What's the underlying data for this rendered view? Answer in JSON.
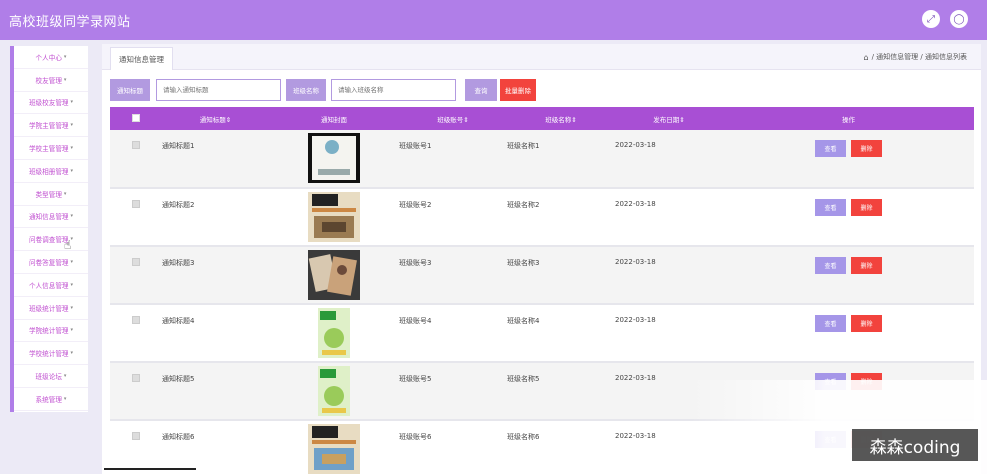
{
  "app": {
    "title": "高校班级同学录网站"
  },
  "top_icons": [
    "fullscreen-icon",
    "user-icon"
  ],
  "sidebar": {
    "items": [
      {
        "label": "个人中心"
      },
      {
        "label": "校友管理"
      },
      {
        "label": "班级校友管理"
      },
      {
        "label": "学院主管管理"
      },
      {
        "label": "学校主管管理"
      },
      {
        "label": "班级相册管理"
      },
      {
        "label": "类型管理"
      },
      {
        "label": "通知信息管理"
      },
      {
        "label": "问卷调查管理"
      },
      {
        "label": "问卷答复管理"
      },
      {
        "label": "个人信息管理"
      },
      {
        "label": "班级统计管理"
      },
      {
        "label": "学院统计管理"
      },
      {
        "label": "学校统计管理"
      },
      {
        "label": "班级论坛"
      },
      {
        "label": "系统管理"
      }
    ]
  },
  "tab": {
    "label": "通知信息管理"
  },
  "breadcrumb": {
    "text": "/ 通知信息管理 / 通知信息列表"
  },
  "search": {
    "title_label": "通知标题",
    "title_placeholder": "请输入通知标题",
    "class_label": "班级名称",
    "class_placeholder": "请输入班级名称",
    "query_button": "查询",
    "batch_delete_button": "批量删除"
  },
  "table": {
    "headers": [
      "通知标题",
      "通知封面",
      "班级账号",
      "班级名称",
      "发布日期",
      "操作"
    ],
    "view_label": "查看",
    "delete_label": "删除",
    "rows": [
      {
        "title": "通知标题1",
        "account": "班级账号1",
        "class_name": "班级名称1",
        "date": "2022-03-18"
      },
      {
        "title": "通知标题2",
        "account": "班级账号2",
        "class_name": "班级名称2",
        "date": "2022-03-18"
      },
      {
        "title": "通知标题3",
        "account": "班级账号3",
        "class_name": "班级名称3",
        "date": "2022-03-18"
      },
      {
        "title": "通知标题4",
        "account": "班级账号4",
        "class_name": "班级名称4",
        "date": "2022-03-18"
      },
      {
        "title": "通知标题5",
        "account": "班级账号5",
        "class_name": "班级名称5",
        "date": "2022-03-18"
      },
      {
        "title": "通知标题6",
        "account": "班级账号6",
        "class_name": "班级名称6",
        "date": "2022-03-18"
      }
    ]
  },
  "watermark": {
    "text": "森森coding"
  },
  "colors": {
    "topbar": "#b07ee8",
    "table_header": "#a84fd4",
    "view_button": "#a596e8",
    "delete_button": "#f2433d",
    "sidebar_text": "#c04fd0"
  }
}
